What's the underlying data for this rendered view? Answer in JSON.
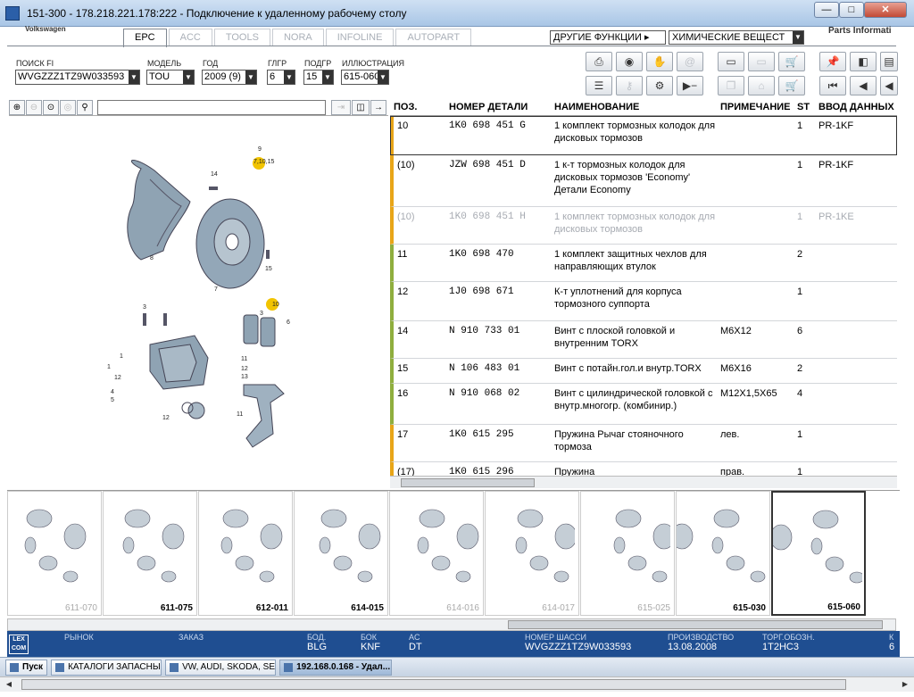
{
  "window": {
    "title": "151-300 - 178.218.221.178:222 - Подключение к удаленному рабочему столу"
  },
  "app": {
    "brand": "Volkswagen",
    "parts_info": "Parts Informati",
    "tabs": [
      {
        "label": "EPC",
        "active": true
      },
      {
        "label": "ACC",
        "active": false
      },
      {
        "label": "TOOLS",
        "active": false
      },
      {
        "label": "NORA",
        "active": false
      },
      {
        "label": "INFOLINE",
        "active": false
      },
      {
        "label": "AUTOPART",
        "active": false
      }
    ],
    "other_functions": "ДРУГИЕ ФУНКЦИИ ▸",
    "chemicals": "ХИМИЧЕСКИЕ ВЕЩЕСТ"
  },
  "filters": {
    "search_label": "ПОИСК FI",
    "search_value": "WVGZZZ1TZ9W033593",
    "model_label": "МОДЕЛЬ",
    "model_value": "TOU",
    "year_label": "ГОД",
    "year_value": "2009 (9)",
    "maingroup_label": "ГЛГР",
    "maingroup_value": "6",
    "subgroup_label": "ПОДГР",
    "subgroup_value": "15",
    "illustration_label": "ИЛЛЮСТРАЦИЯ",
    "illustration_value": "615-060"
  },
  "grid": {
    "headers": {
      "pos": "ПОЗ.",
      "number": "НОМЕР ДЕТАЛИ",
      "name": "НАИМЕНОВАНИЕ",
      "remark": "ПРИМЕЧАНИЕ",
      "st": "ST",
      "intro": "ВВОД ДАННЫХ ПО"
    },
    "rows": [
      {
        "pos": "10",
        "number": "1K0  698  451  G",
        "name": "1 комплект тормозных колодок для дисковых тормозов",
        "remark": "",
        "st": "1",
        "intro": "PR-1KF"
      },
      {
        "pos": "(10)",
        "number": "JZW  698  451  D",
        "name": "1 к-т тормозных колодок для дисковых тормозов 'Economy' Детали Economy",
        "remark": "",
        "st": "1",
        "intro": "PR-1KF"
      },
      {
        "pos": "(10)",
        "number": "1K0  698  451  H",
        "name": "1 комплект тормозных колодок для дисковых тормозов",
        "remark": "",
        "st": "1",
        "intro": "PR-1KE"
      },
      {
        "pos": "11",
        "number": "1K0  698  470",
        "name": "1 комплект защитных чехлов для направляющих втулок",
        "remark": "",
        "st": "2",
        "intro": ""
      },
      {
        "pos": "12",
        "number": "1J0  698  671",
        "name": "К-т уплотнений для корпуса тормозного суппорта",
        "remark": "",
        "st": "1",
        "intro": ""
      },
      {
        "pos": "14",
        "number": "N    910  733  01",
        "name": "Винт с плоской головкой и внутренним TORX",
        "remark": "M6X12",
        "st": "6",
        "intro": ""
      },
      {
        "pos": "15",
        "number": "N    106  483  01",
        "name": "Винт с потайн.гол.и внутр.TORX",
        "remark": "M6X16",
        "st": "2",
        "intro": ""
      },
      {
        "pos": "16",
        "number": "N    910  068  02",
        "name": "Винт с цилиндрической головкой с внутр.многогр. (комбинир.)",
        "remark": "M12X1,5X65",
        "st": "4",
        "intro": ""
      },
      {
        "pos": "17",
        "number": "1K0  615  295",
        "name": "Пружина Рычаг стояночного тормоза",
        "remark": "лев.",
        "st": "1",
        "intro": ""
      },
      {
        "pos": "(17)",
        "number": "1K0  615  296",
        "name": "Пружина",
        "remark": "прав.",
        "st": "1",
        "intro": ""
      }
    ]
  },
  "illustration": {
    "callouts": [
      "9",
      "7,10,15",
      "14",
      "8",
      "15",
      "7",
      "10",
      "3",
      "6",
      "3",
      "1",
      "12",
      "4",
      "5",
      "11",
      "12",
      "13",
      "12",
      "11",
      "1"
    ]
  },
  "thumbnails": [
    {
      "label": "611-070"
    },
    {
      "label": "611-075"
    },
    {
      "label": "612-011"
    },
    {
      "label": "614-015"
    },
    {
      "label": "614-016"
    },
    {
      "label": "614-017"
    },
    {
      "label": "615-025"
    },
    {
      "label": "615-030"
    },
    {
      "label": "615-060"
    }
  ],
  "status": {
    "logo": "LEX COM",
    "market_label": "РЫНОК",
    "order_label": "ЗАКАЗ",
    "bod_label": "БОД.",
    "bod_value": "BLG",
    "box_label": "БОК",
    "box_value": "KNF",
    "ac_label": "AC",
    "ac_value": "DT",
    "chassis_label": "НОМЕР ШАССИ",
    "chassis_value": "WVGZZZ1TZ9W033593",
    "prod_label": "ПРОИЗВОДСТВО",
    "prod_value": "13.08.2008",
    "trade_label": "ТОРГ.ОБОЗН.",
    "trade_value": "1T2HC3",
    "k_label": "К",
    "k_value": "6"
  },
  "taskbar": {
    "start": "Пуск",
    "items": [
      {
        "label": "КАТАЛОГИ ЗАПАСНЫХ ..."
      },
      {
        "label": "VW, AUDI, SKODA, SEAT"
      },
      {
        "label": "192.168.0.168 - Удал..."
      }
    ]
  }
}
